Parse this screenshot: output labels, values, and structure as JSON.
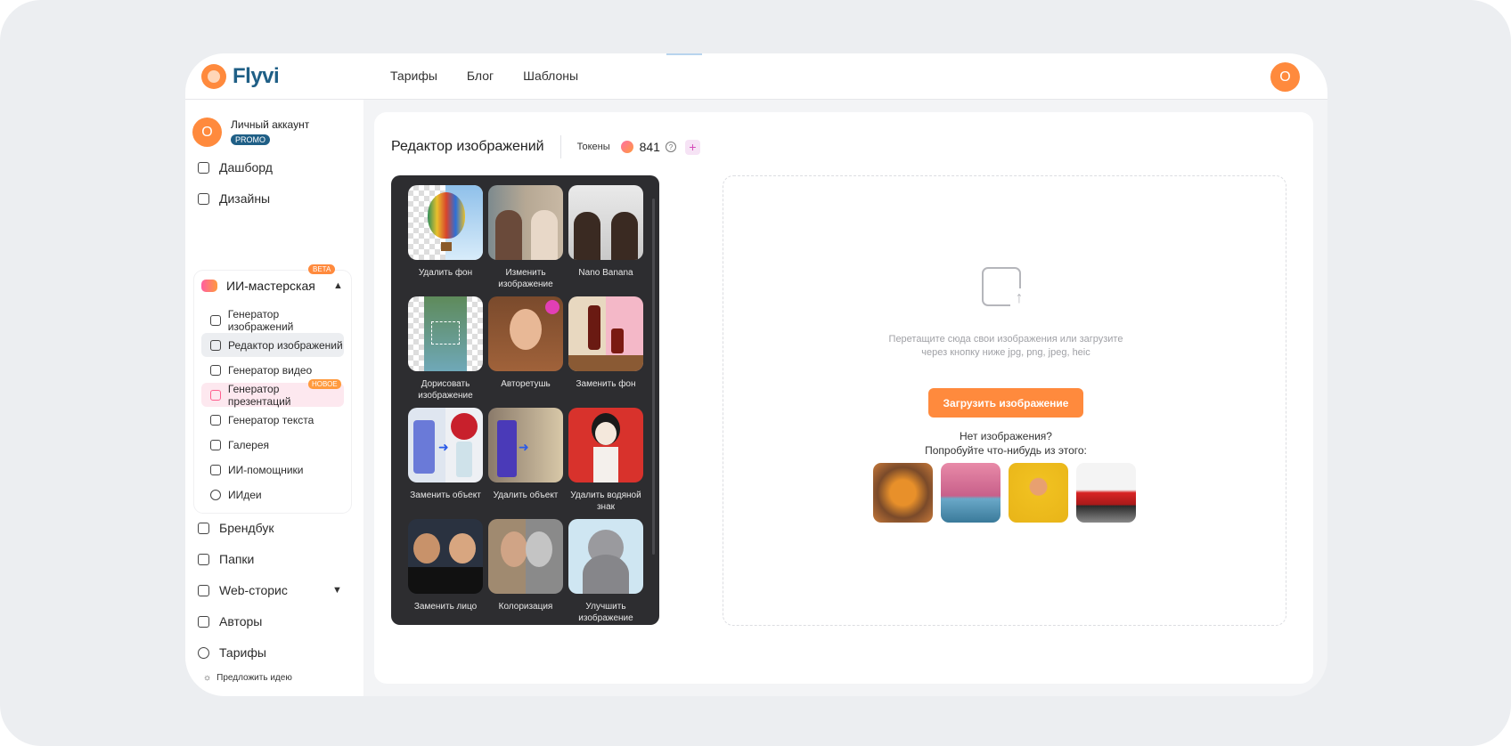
{
  "app": {
    "logo_text": "Flyvi"
  },
  "topnav": [
    "Тарифы",
    "Блог",
    "Шаблоны"
  ],
  "user_initial": "О",
  "account": {
    "initial": "О",
    "name": "Личный аккаунт",
    "badge": "PROMO"
  },
  "sidebar": {
    "dashboard": "Дашборд",
    "designs": "Дизайны",
    "ai_workshop": {
      "label": "ИИ-мастерская",
      "badge": "BETA"
    },
    "sub_items": [
      "Генератор изображений",
      "Редактор изображений",
      "Генератор видео",
      "Генератор презентаций",
      "Генератор текста",
      "Галерея",
      "ИИ-помощники",
      "ИИдеи"
    ],
    "new_badge": "НОВОЕ",
    "brandbook": "Брендбук",
    "folders": "Папки",
    "web_stories": "Web-сторис",
    "authors": "Авторы",
    "tariffs": "Тарифы",
    "suggest": "Предложить идею"
  },
  "editor": {
    "title": "Редактор изображений",
    "tokens_label": "Токены",
    "tokens_value": "841",
    "help": "?",
    "plus": "+"
  },
  "tools": [
    "Удалить фон",
    "Изменить изображение",
    "Nano Banana",
    "Дорисовать изображение",
    "Авторетушь",
    "Заменить фон",
    "Заменить объект",
    "Удалить объект",
    "Удалить водяной знак",
    "Заменить лицо",
    "Колоризация",
    "Улучшить изображение"
  ],
  "upload": {
    "hint": "Перетащите сюда свои изображения или загрузите через кнопку ниже jpg, png, jpeg, heic",
    "button": "Загрузить изображение",
    "no_image_1": "Нет изображения?",
    "no_image_2": "Попробуйте что-нибудь из этого:"
  },
  "colors": {
    "accent": "#ff8a3d",
    "brand": "#1f5f86",
    "tools_bg": "#2d2d30"
  }
}
